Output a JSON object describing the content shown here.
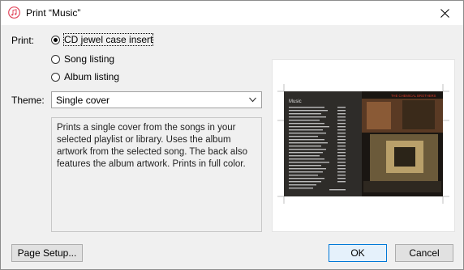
{
  "window": {
    "title": "Print “Music”"
  },
  "print": {
    "label": "Print:",
    "options": [
      {
        "label": "CD jewel case insert",
        "selected": true
      },
      {
        "label": "Song listing",
        "selected": false
      },
      {
        "label": "Album listing",
        "selected": false
      }
    ]
  },
  "theme": {
    "label": "Theme:",
    "selected": "Single cover",
    "description": "Prints a single cover from the songs in your selected playlist or library. Uses the album artwork from the selected song. The back also features the album artwork. Prints in full color."
  },
  "preview": {
    "back_title": "Music",
    "front_caption": "THE CHEMICAL BROTHERS"
  },
  "buttons": {
    "page_setup": "Page Setup...",
    "ok": "OK",
    "cancel": "Cancel"
  },
  "colors": {
    "accent": "#0078d7",
    "app_icon": "#e2495e"
  }
}
